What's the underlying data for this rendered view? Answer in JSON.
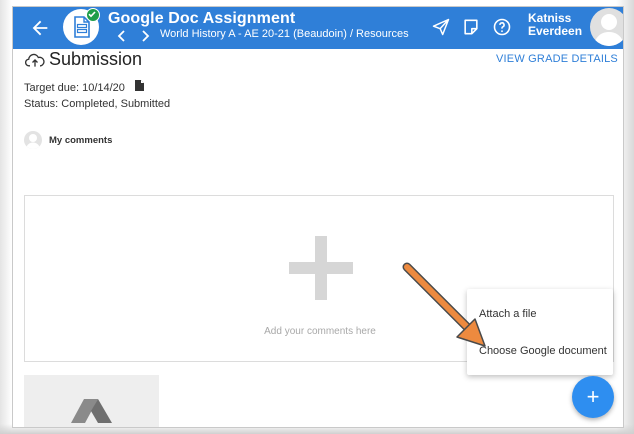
{
  "header": {
    "title": "Google Doc Assignment",
    "breadcrumb": "World History A - AE 20-21 (Beaudoin) / Resources",
    "user_first": "Katniss",
    "user_last": "Everdeen",
    "icons": [
      "back-arrow-icon",
      "document-icon",
      "check-icon",
      "chevron-left-icon",
      "chevron-right-icon",
      "send-icon",
      "note-icon",
      "help-icon",
      "avatar"
    ]
  },
  "submission": {
    "title": "Submission",
    "view_grade_label": "VIEW GRADE DETAILS",
    "target_due": "Target due: 10/14/20",
    "status": "Status: Completed, Submitted"
  },
  "comments": {
    "label": "My comments",
    "placeholder": "Add your comments here"
  },
  "menu": {
    "items": [
      {
        "label": "Attach a file"
      },
      {
        "label": "Choose Google document"
      }
    ]
  },
  "fab": {
    "label": "+"
  },
  "colors": {
    "header_bg": "#2f7fd8",
    "link": "#2f7fd8",
    "fab": "#2e8ef0",
    "arrow": "#ed8a3f",
    "success": "#1e9e4a"
  }
}
